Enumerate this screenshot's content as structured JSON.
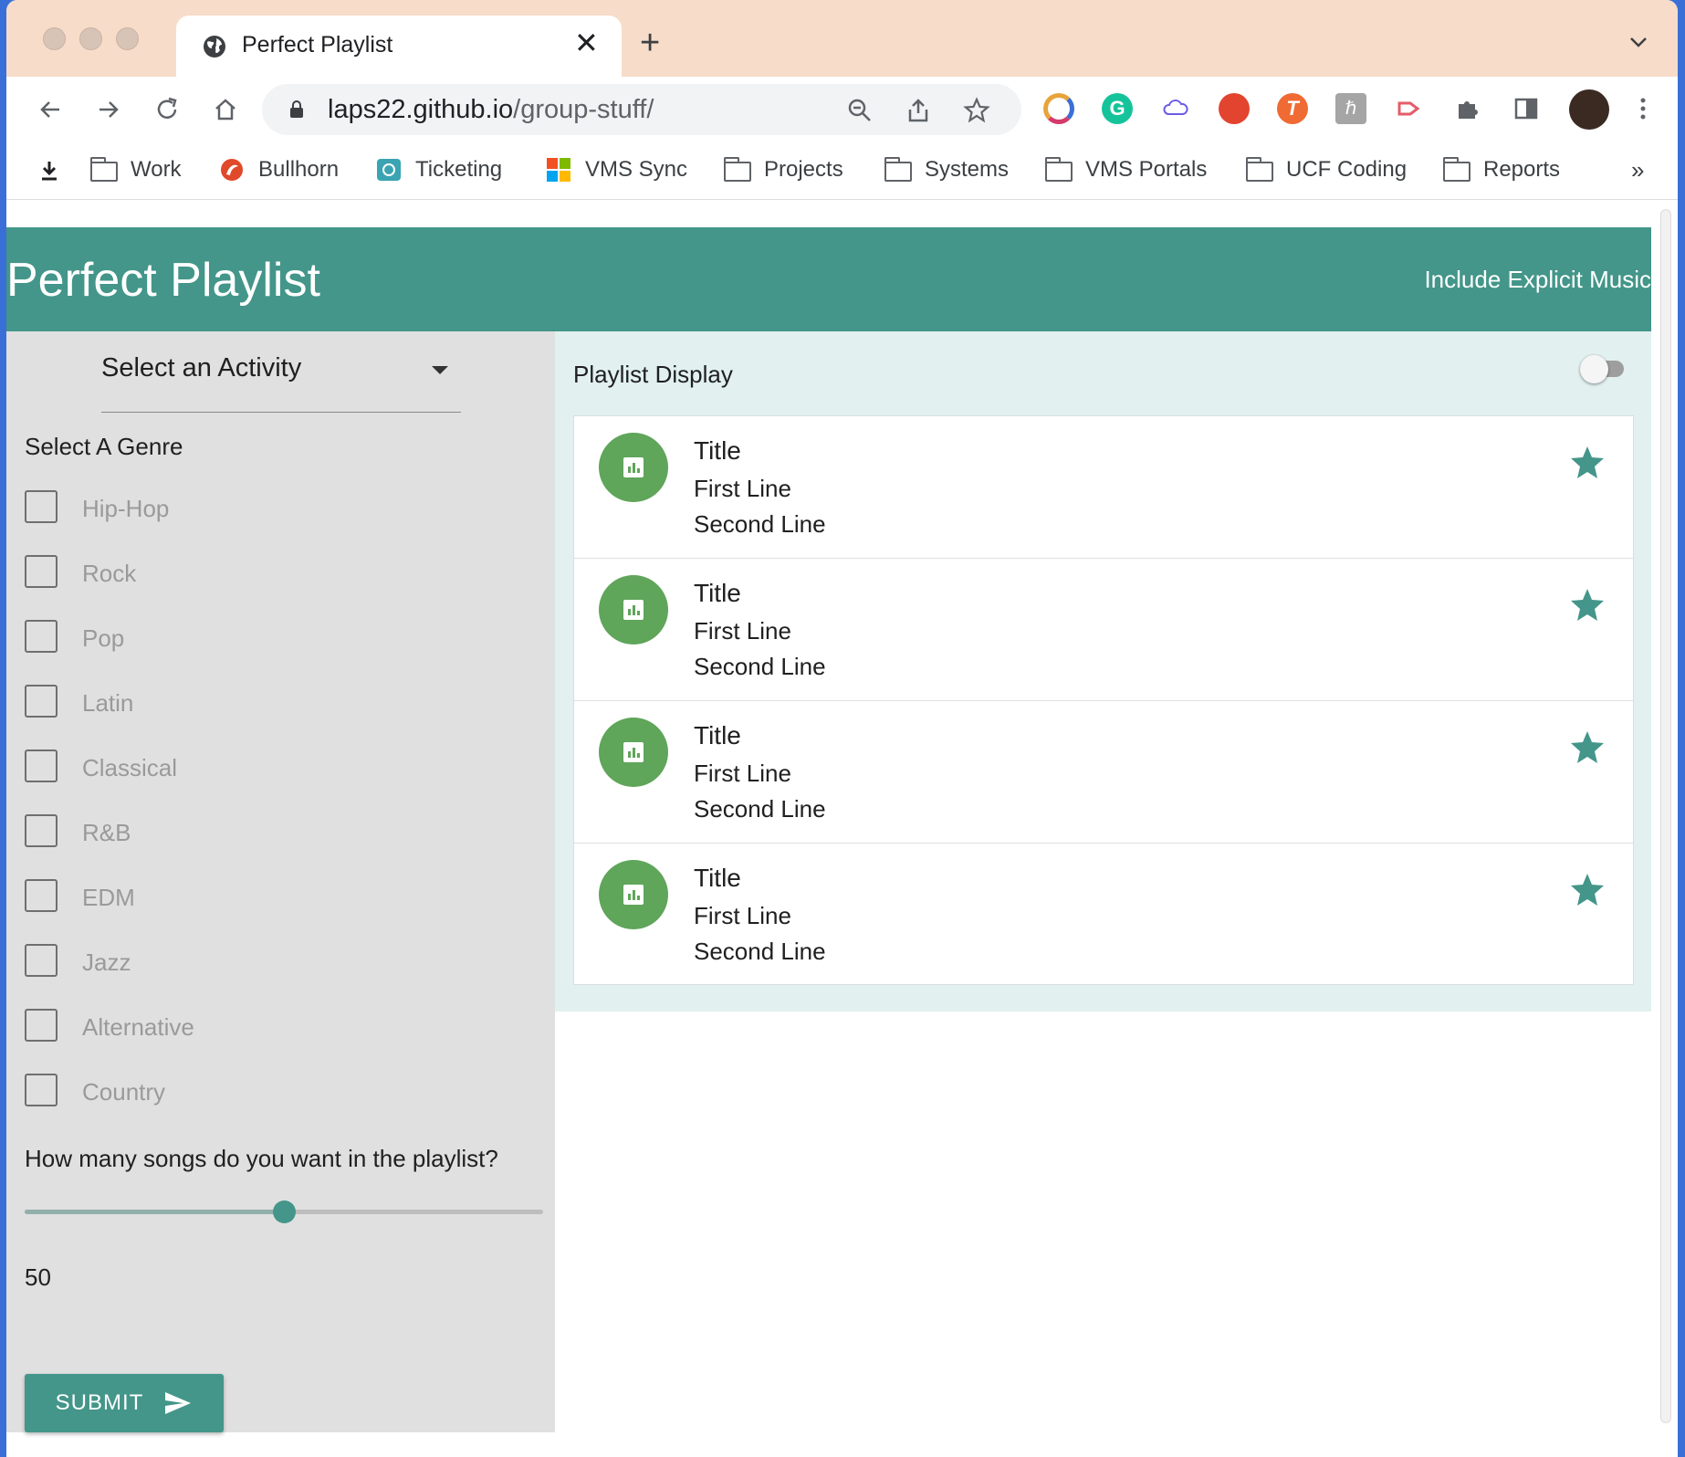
{
  "browser": {
    "tab_title": "Perfect Playlist",
    "url_host": "laps22.github.io",
    "url_path": "/group-stuff/",
    "bookmarks": [
      {
        "label": "Work",
        "icon": "folder-icon"
      },
      {
        "label": "Bullhorn",
        "icon": "bullhorn-icon"
      },
      {
        "label": "Ticketing",
        "icon": "ticketing-icon"
      },
      {
        "label": "VMS Sync",
        "icon": "microsoft-icon"
      },
      {
        "label": "Projects",
        "icon": "folder-icon"
      },
      {
        "label": "Systems",
        "icon": "folder-icon"
      },
      {
        "label": "VMS Portals",
        "icon": "folder-icon"
      },
      {
        "label": "UCF Coding",
        "icon": "folder-icon"
      },
      {
        "label": "Reports",
        "icon": "folder-icon"
      }
    ],
    "bookmarks_overflow": "»"
  },
  "app": {
    "title": "Perfect Playlist",
    "explicit_label": "Include Explicit Music",
    "activity_select": "Select an Activity",
    "genre_heading": "Select A Genre",
    "genres": [
      "Hip-Hop",
      "Rock",
      "Pop",
      "Latin",
      "Classical",
      "R&B",
      "EDM",
      "Jazz",
      "Alternative",
      "Country"
    ],
    "songs_question": "How many songs do you want in the playlist?",
    "songs_value": "50",
    "songs_fraction": 0.5,
    "submit_label": "SUBMIT",
    "playlist_heading": "Playlist Display",
    "playlist_toggle_on": false,
    "playlist_items": [
      {
        "title": "Title",
        "line1": "First Line",
        "line2": "Second Line"
      },
      {
        "title": "Title",
        "line1": "First Line",
        "line2": "Second Line"
      },
      {
        "title": "Title",
        "line1": "First Line",
        "line2": "Second Line"
      },
      {
        "title": "Title",
        "line1": "First Line",
        "line2": "Second Line"
      }
    ]
  },
  "colors": {
    "primary": "#439689",
    "avatar": "#5fa55a",
    "sidebar_bg": "#e0e0e0",
    "main_bg": "#e2f0f0",
    "tabstrip_bg": "#f7dcc9"
  }
}
